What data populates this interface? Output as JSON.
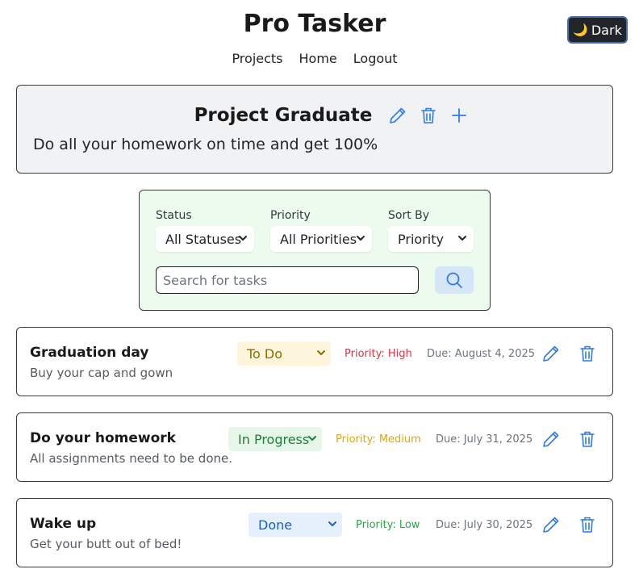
{
  "header": {
    "app_title": "Pro Tasker",
    "theme_toggle": {
      "icon": "moon-icon",
      "glyph": "🌙",
      "label": "Dark"
    }
  },
  "nav": {
    "items": [
      "Projects",
      "Home",
      "Logout"
    ]
  },
  "project": {
    "title": "Project Graduate",
    "description": "Do all your homework on time and get 100%",
    "actions": [
      "edit-icon",
      "trash-icon",
      "plus-icon"
    ]
  },
  "filters": {
    "status": {
      "label": "Status",
      "value": "All Statuses"
    },
    "priority": {
      "label": "Priority",
      "value": "All Priorities"
    },
    "sort": {
      "label": "Sort By",
      "value": "Priority"
    },
    "search": {
      "placeholder": "Search for tasks",
      "button_icon": "search-icon"
    }
  },
  "tasks": [
    {
      "title": "Graduation day",
      "description": "Buy your cap and gown",
      "status": "To Do",
      "priority": "Priority: High",
      "due": "Due: August 4, 2025"
    },
    {
      "title": "Do your homework",
      "description": "All assignments need to be done.",
      "status": "In Progress",
      "priority": "Priority: Medium",
      "due": "Due: July 31, 2025"
    },
    {
      "title": "Wake up",
      "description": "Get your butt out of bed!",
      "status": "Done",
      "priority": "Priority: Low",
      "due": "Due: July 30, 2025"
    }
  ],
  "colors": {
    "accent_blue": "#2f7be8",
    "priority_high": "#dc3545",
    "priority_medium": "#e0a800",
    "priority_low": "#28a745",
    "status_todo_bg": "#fdf6dd",
    "status_inprogress_bg": "#e6f7ea",
    "status_done_bg": "#e6f0fd"
  }
}
